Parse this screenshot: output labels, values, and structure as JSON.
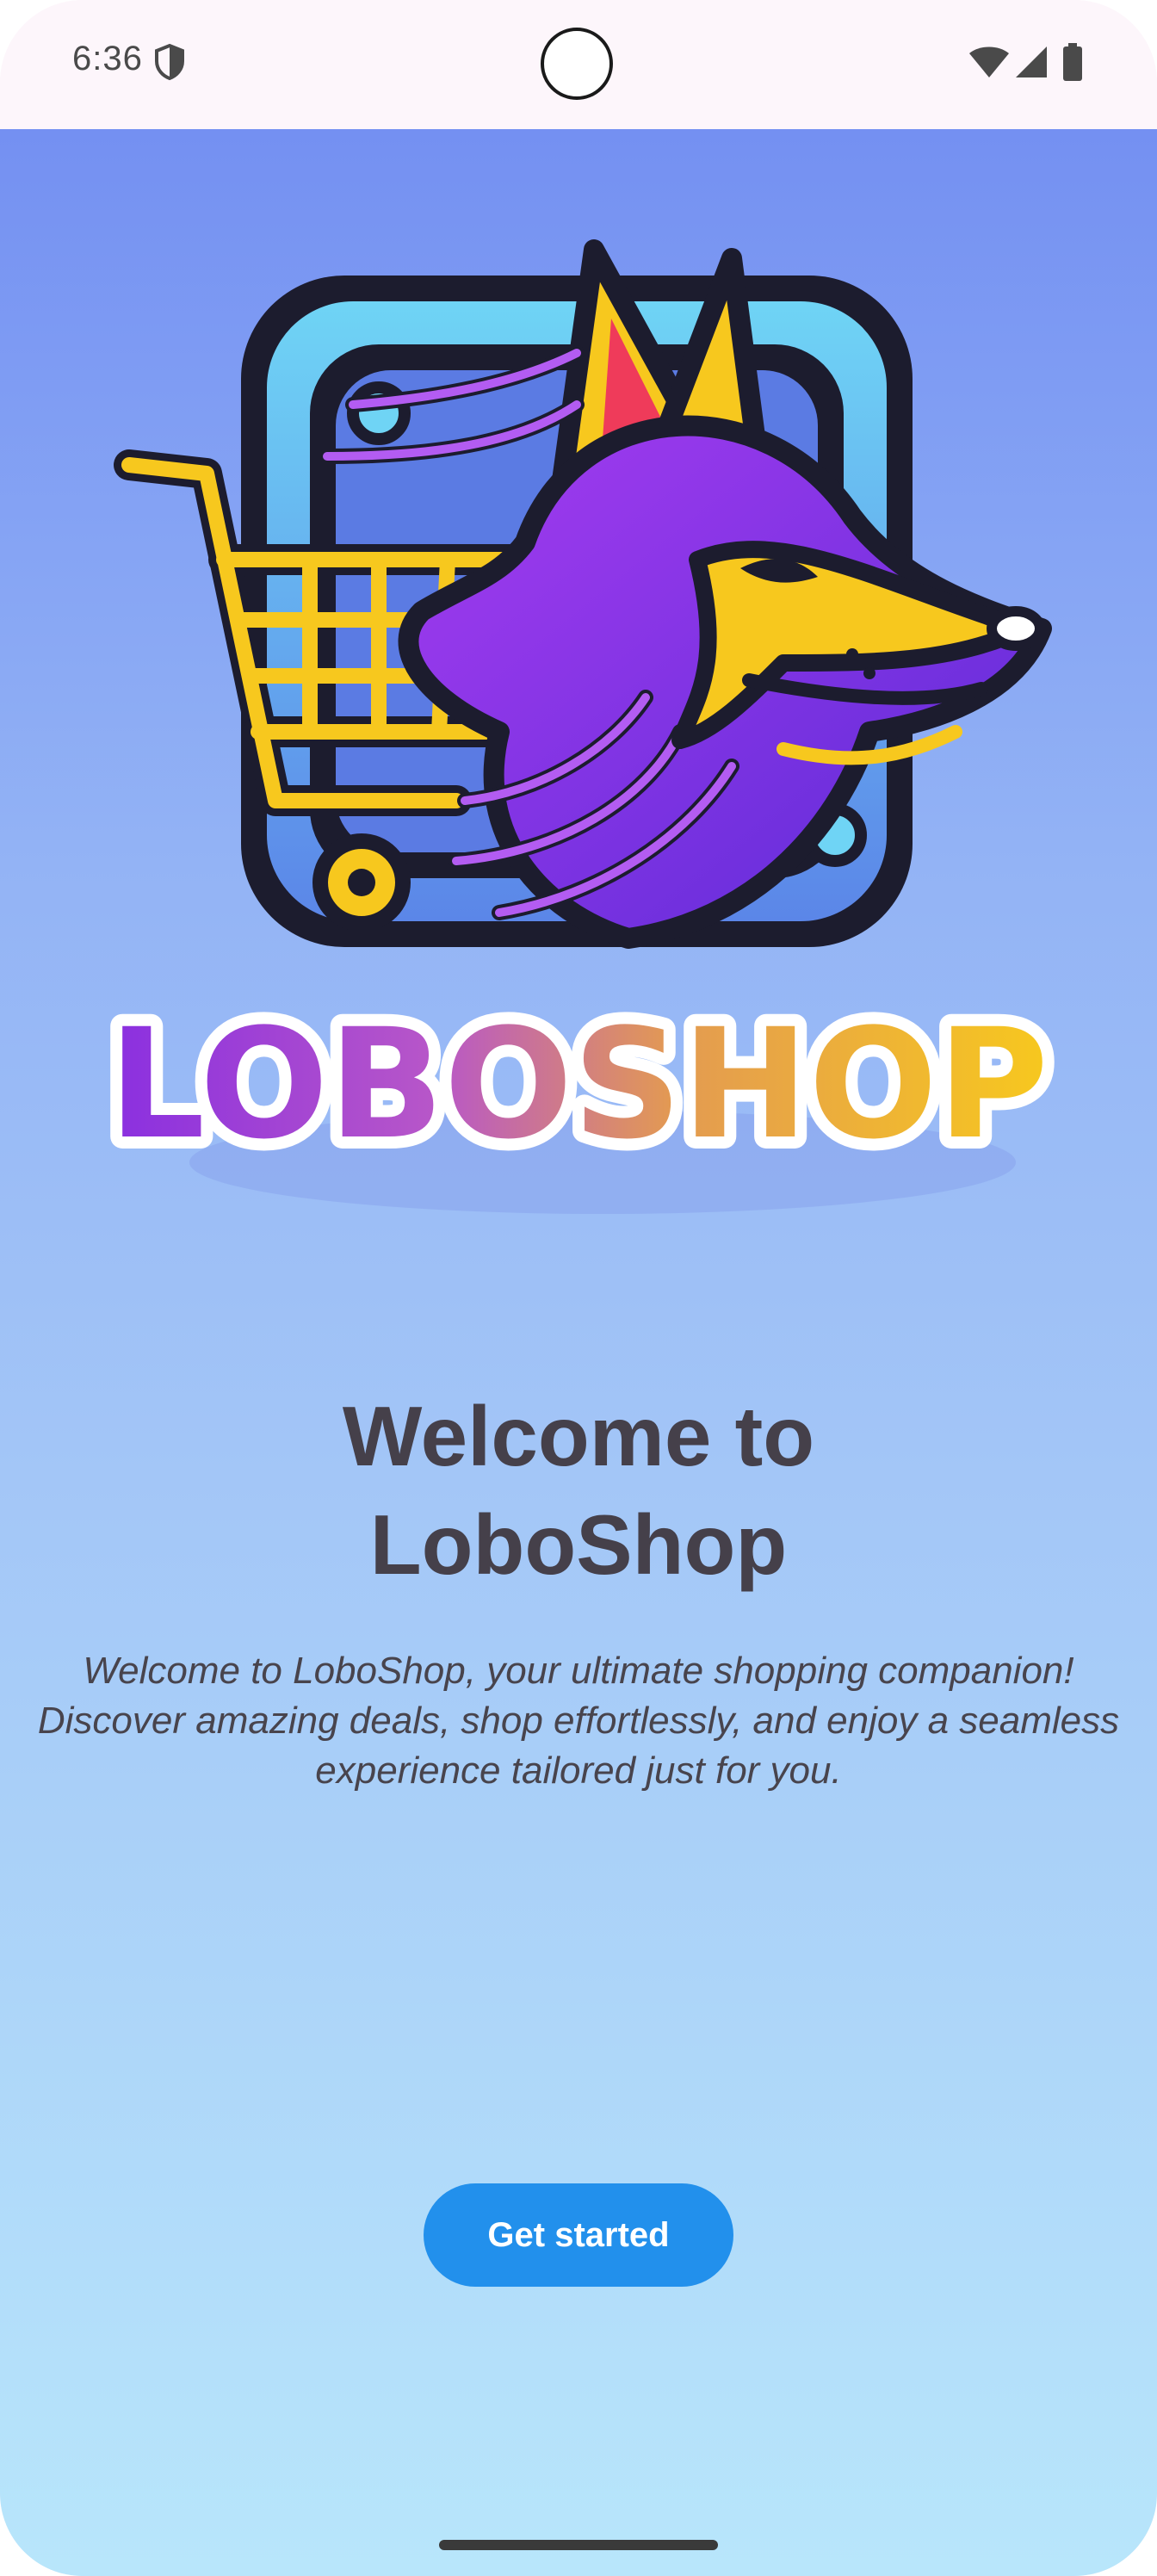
{
  "status_bar": {
    "time": "6:36",
    "icons": [
      "shield-icon",
      "wifi-icon",
      "signal-icon",
      "battery-icon"
    ]
  },
  "logo": {
    "wordmark": "LOBOSHOP",
    "image": "wolf-shopping-cart-logo"
  },
  "welcome": {
    "title": "Welcome to LoboShop",
    "description": "Welcome to LoboShop, your ultimate shopping companion! Discover amazing deals, shop effortlessly, and enjoy a seamless experience tailored just for you."
  },
  "actions": {
    "get_started_label": "Get started"
  },
  "colors": {
    "background_top": "#7490f2",
    "background_bottom": "#b8e6fb",
    "button": "#2290ec",
    "title_text": "#45404a",
    "logo_purple": "#8a2fe0",
    "logo_yellow": "#f7c81e"
  }
}
